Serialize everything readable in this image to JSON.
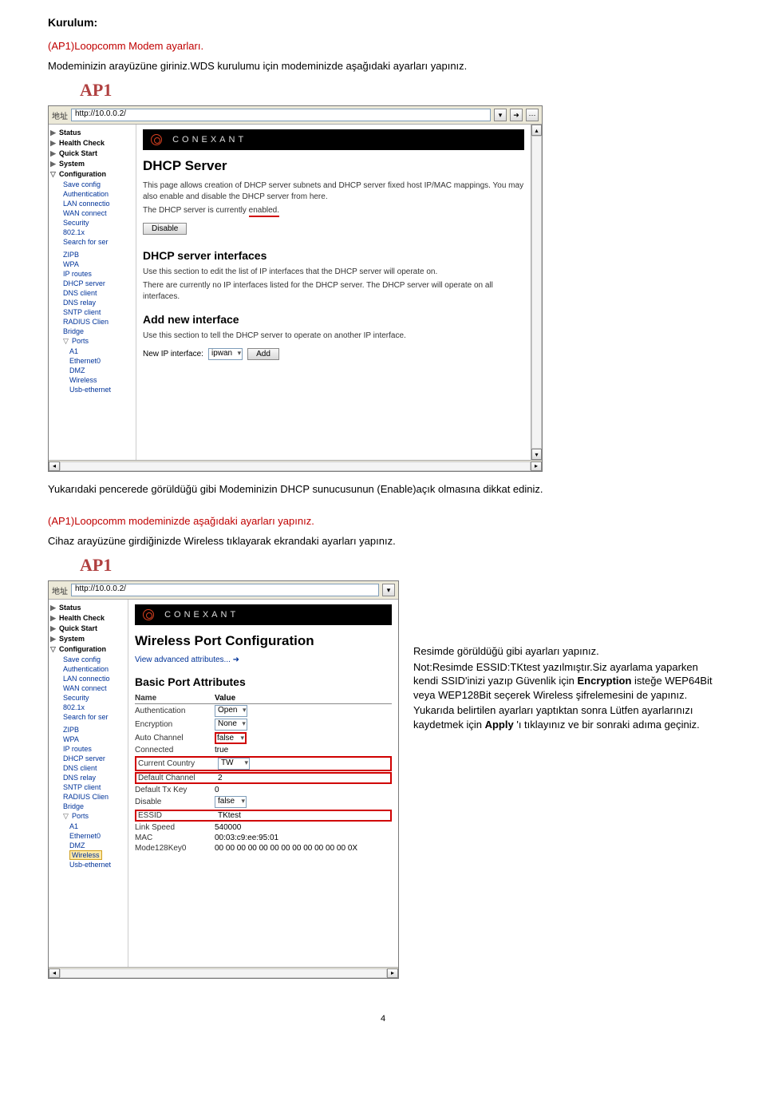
{
  "doc": {
    "heading": "Kurulum:",
    "line1": "(AP1)Loopcomm Modem ayarları.",
    "line2": "Modeminizin arayüzüne giriniz.WDS kurulumu için modeminizde aşağıdaki ayarları yapınız.",
    "ap_label_1": "AP1",
    "after_sc1_a": "Yukarıdaki pencerede görüldüğü gibi Modeminizin DHCP sunucusunun (Enable)açık olmasına dikkat ediniz.",
    "after_sc1_b": "(AP1)Loopcomm modeminizde aşağıdaki ayarları yapınız.",
    "after_sc1_c": "Cihaz arayüzüne girdiğinizde Wireless tıklayarak ekrandaki ayarları yapınız.",
    "ap_label_2": "AP1",
    "page_number": "4"
  },
  "advice": {
    "l1": "Resimde görüldüğü gibi ayarları yapınız.",
    "l2a": "Not:Resimde ESSID:TKtest yazılmıştır.Siz ayarlama yaparken kendi SSID'inizi yazıp Güvenlik için ",
    "l2_enc": "Encryption",
    "l2b": " isteğe WEP64Bit veya WEP128Bit seçerek Wireless şifrelemesini de yapınız.",
    "l3a": "Yukarıda belirtilen ayarları yaptıktan sonra Lütfen ayarlarınızı kaydetmek için ",
    "l3_apply": "Apply",
    "l3b": "'ı tıklayınız ve bir sonraki adıma geçiniz."
  },
  "sc1": {
    "addr_label": "地址",
    "addr_value": "http://10.0.0.2/",
    "brand": "CONEXANT",
    "sidebar": {
      "items": [
        {
          "icon": "▶",
          "label": "Status"
        },
        {
          "icon": "▶",
          "label": "Health Check"
        },
        {
          "icon": "▶",
          "label": "Quick Start"
        },
        {
          "icon": "▶",
          "label": "System"
        },
        {
          "icon": "▽",
          "label": "Configuration"
        }
      ],
      "config_children": [
        "Save config",
        "Authentication",
        "LAN connectio",
        "WAN connect",
        "Security",
        "802.1x",
        "Search for ser"
      ],
      "groups": [
        "ZIPB",
        "WPA",
        "IP routes",
        "DHCP server",
        "DNS client",
        "DNS relay",
        "SNTP client",
        "RADIUS Clien",
        "Bridge"
      ],
      "ports_label": "Ports",
      "ports_children": [
        "A1",
        "Ethernet0",
        "DMZ",
        "Wireless",
        "Usb-ethernet"
      ]
    },
    "title": "DHCP Server",
    "intro": "This page allows creation of DHCP server subnets and DHCP server fixed host IP/MAC mappings. You may also enable and disable the DHCP server from here.",
    "status_text_a": "The DHCP server is currently ",
    "status_text_b": "enabled.",
    "disable_btn": "Disable",
    "sub1": "DHCP server interfaces",
    "sub1_text": "Use this section to edit the list of IP interfaces that the DHCP server will operate on.",
    "sub1_text2": "There are currently no IP interfaces listed for the DHCP server. The DHCP server will operate on all interfaces.",
    "sub2": "Add new interface",
    "sub2_text": "Use this section to tell the DHCP server to operate on another IP interface.",
    "new_ip_label": "New IP interface:",
    "new_ip_value": "ipwan",
    "add_btn": "Add"
  },
  "sc2": {
    "addr_label": "地址",
    "addr_value": "http://10.0.0.2/",
    "brand": "CONEXANT",
    "sidebar": {
      "items": [
        {
          "icon": "▶",
          "label": "Status"
        },
        {
          "icon": "▶",
          "label": "Health Check"
        },
        {
          "icon": "▶",
          "label": "Quick Start"
        },
        {
          "icon": "▶",
          "label": "System"
        },
        {
          "icon": "▽",
          "label": "Configuration"
        }
      ],
      "config_children": [
        "Save config",
        "Authentication",
        "LAN connectio",
        "WAN connect",
        "Security",
        "802.1x",
        "Search for ser"
      ],
      "groups": [
        "ZIPB",
        "WPA",
        "IP routes",
        "DHCP server",
        "DNS client",
        "DNS relay",
        "SNTP client",
        "RADIUS Clien",
        "Bridge"
      ],
      "ports_label": "Ports",
      "ports_children": [
        "A1",
        "Ethernet0",
        "DMZ",
        "Wireless",
        "Usb-ethernet"
      ]
    },
    "title": "Wireless Port Configuration",
    "adv_link": "View advanced attributes...",
    "basic_heading": "Basic Port Attributes",
    "col_name": "Name",
    "col_value": "Value",
    "attrs": [
      {
        "name": "Authentication",
        "value": "Open",
        "type": "select"
      },
      {
        "name": "Encryption",
        "value": "None",
        "type": "select"
      },
      {
        "name": "Auto Channel",
        "value": "false",
        "type": "select",
        "boxed": true
      },
      {
        "name": "Connected",
        "value": "true",
        "type": "text"
      },
      {
        "name": "Current Country",
        "value": "TW",
        "type": "select",
        "rowboxed": true
      },
      {
        "name": "Default Channel",
        "value": "2",
        "type": "text",
        "rowboxed": true
      },
      {
        "name": "Default Tx Key",
        "value": "0",
        "type": "text"
      },
      {
        "name": "Disable",
        "value": "false",
        "type": "select"
      },
      {
        "name": "ESSID",
        "value": "TKtest",
        "type": "text",
        "rowboxed": true
      },
      {
        "name": "Link Speed",
        "value": "540000",
        "type": "text"
      },
      {
        "name": "MAC",
        "value": "00:03:c9:ee:95:01",
        "type": "text"
      },
      {
        "name": "Mode128Key0",
        "value": "00 00 00 00 00 00 00 00 00 00 00 00 0X",
        "type": "text"
      }
    ]
  }
}
